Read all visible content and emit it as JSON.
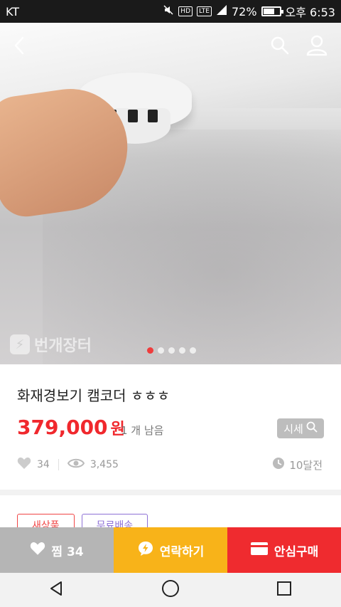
{
  "status": {
    "carrier": "KT",
    "hd": "HD",
    "lte": "LTE",
    "battery": "72%",
    "battery_level": 0.72,
    "time": "오후 6:53"
  },
  "header": {
    "back_icon": "back-arrow-icon",
    "search_icon": "search-icon",
    "profile_icon": "profile-icon"
  },
  "gallery": {
    "watermark": "번개장터",
    "pages": 5,
    "current_page": 1
  },
  "product": {
    "title": "화재경보기 캠코더 ㅎㅎㅎ",
    "price": "379,000",
    "price_unit": "원",
    "stock": "1 개 남음",
    "sise_label": "시세",
    "likes": "34",
    "views": "3,455",
    "posted": "10달전"
  },
  "tags": {
    "new": "새상품",
    "shipping": "무료배송"
  },
  "actions": {
    "like_label": "찜 34",
    "contact_label": "연락하기",
    "buy_label": "안심구매"
  },
  "colors": {
    "price": "#f0282d",
    "contact": "#f8b319",
    "buy": "#ef2b2f",
    "like": "#b5b5b5"
  }
}
